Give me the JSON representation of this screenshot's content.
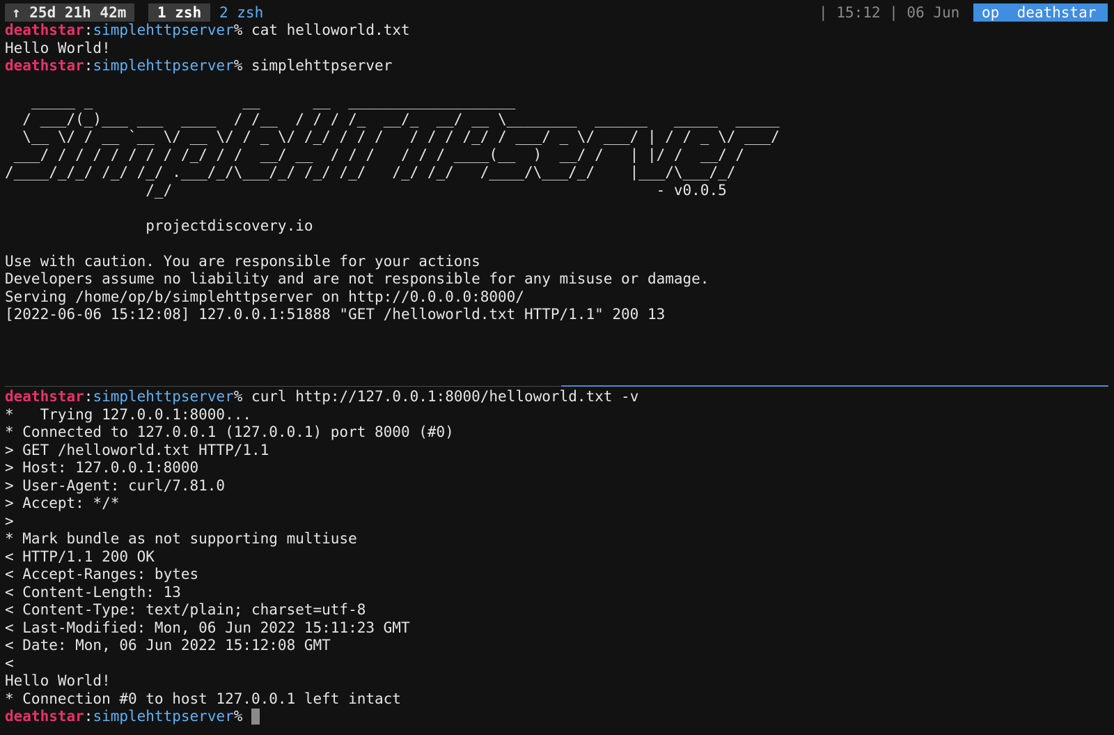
{
  "statusbar": {
    "uptime": "↑ 25d 21h 42m",
    "window_active": "1 zsh",
    "window_inactive": "2 zsh",
    "clock": "| 15:12 | 06 Jun",
    "user_host": "op  deathstar"
  },
  "prompt": {
    "host": "deathstar",
    "sep": ":",
    "path": "simplehttpserver",
    "suffix": "% "
  },
  "top_pane": {
    "cmd1": "cat helloworld.txt",
    "out1": "Hello World!",
    "cmd2": "simplehttpserver",
    "banner": "   _____ _                 __      __  ___________________ \n  / ___/(_)___ ___  ____  / /__  / / / /_  __/_  __/ __ \\________  ______   _____  _____\n  \\__ \\/ / __ `__ \\/ __ \\/ / _ \\/ /_/ / / /   / / / /_/ / ___/ _ \\/ ___/ | / / _ \\/ ___/\n ___/ / / / / / / / /_/ / /  __/ __  / / /   / / / ____(__  )  __/ /   | |/ /  __/ /    \n/____/_/_/ /_/ /_/ .___/_/\\___/_/ /_/ /_/   /_/ /_/   /____/\\___/_/    |___/\\___/_/     \n                /_/                                                       - v0.0.5",
    "website": "                projectdiscovery.io",
    "notice1": "Use with caution. You are responsible for your actions",
    "notice2": "Developers assume no liability and are not responsible for any misuse or damage.",
    "serving": "Serving /home/op/b/simplehttpserver on http://0.0.0.0:8000/",
    "log": "[2022-06-06 15:12:08] 127.0.0.1:51888 \"GET /helloworld.txt HTTP/1.1\" 200 13"
  },
  "bottom_pane": {
    "cmd": "curl http://127.0.0.1:8000/helloworld.txt -v",
    "lines": [
      "*   Trying 127.0.0.1:8000...",
      "* Connected to 127.0.0.1 (127.0.0.1) port 8000 (#0)",
      "> GET /helloworld.txt HTTP/1.1",
      "> Host: 127.0.0.1:8000",
      "> User-Agent: curl/7.81.0",
      "> Accept: */*",
      ">",
      "* Mark bundle as not supporting multiuse",
      "< HTTP/1.1 200 OK",
      "< Accept-Ranges: bytes",
      "< Content-Length: 13",
      "< Content-Type: text/plain; charset=utf-8",
      "< Last-Modified: Mon, 06 Jun 2022 15:11:23 GMT",
      "< Date: Mon, 06 Jun 2022 15:12:08 GMT",
      "<",
      "Hello World!",
      "* Connection #0 to host 127.0.0.1 left intact"
    ]
  },
  "colors": {
    "background": "#121212",
    "host": "#e8336a",
    "path": "#5fb3f6",
    "accent": "#3f8ee0"
  }
}
